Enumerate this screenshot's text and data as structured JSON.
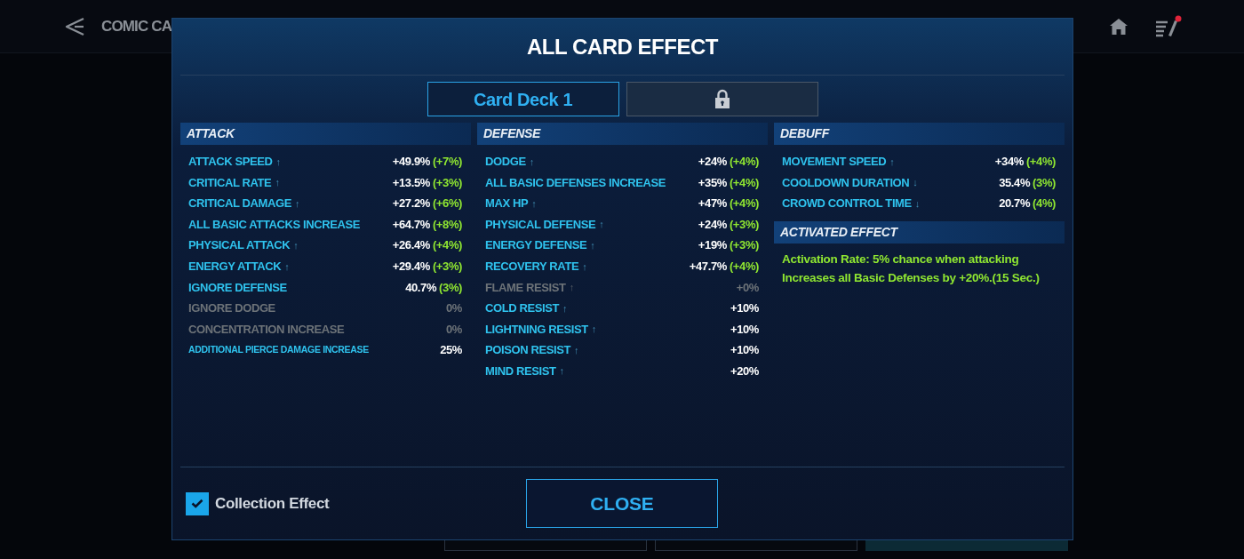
{
  "background": {
    "title": "COMIC CA"
  },
  "dialog": {
    "title": "ALL CARD EFFECT",
    "tabs": [
      {
        "kind": "deck",
        "label": "Card Deck 1",
        "selected": true
      },
      {
        "kind": "locked",
        "selected": false
      }
    ],
    "sections": [
      {
        "title": "ATTACK",
        "rows": [
          {
            "kind": "normal",
            "label": "ATTACK SPEED",
            "arrow": "↑",
            "value": "+49.9%",
            "bonus": "(+7%)",
            "disabled": false
          },
          {
            "kind": "normal",
            "label": "CRITICAL RATE",
            "arrow": "↑",
            "value": "+13.5%",
            "bonus": "(+3%)",
            "disabled": false
          },
          {
            "kind": "normal",
            "label": "CRITICAL DAMAGE",
            "arrow": "↑",
            "value": "+27.2%",
            "bonus": "(+6%)",
            "disabled": false
          },
          {
            "kind": "normal",
            "label": "ALL BASIC ATTACKS INCREASE",
            "value": "+64.7%",
            "bonus": "(+8%)",
            "disabled": false
          },
          {
            "kind": "normal",
            "label": "PHYSICAL ATTACK",
            "arrow": "↑",
            "value": "+26.4%",
            "bonus": "(+4%)",
            "disabled": false
          },
          {
            "kind": "normal",
            "label": "ENERGY ATTACK",
            "arrow": "↑",
            "value": "+29.4%",
            "bonus": "(+3%)",
            "disabled": false
          },
          {
            "kind": "normal",
            "label": "IGNORE DEFENSE",
            "value": "40.7%",
            "bonus": "(3%)",
            "disabled": false
          },
          {
            "kind": "normal",
            "label": "IGNORE DODGE",
            "value": "0%",
            "disabled": true
          },
          {
            "kind": "normal",
            "label": "CONCENTRATION INCREASE",
            "value": "0%",
            "disabled": true
          },
          {
            "kind": "compact",
            "label": "ADDITIONAL PIERCE DAMAGE INCREASE",
            "value": "25%",
            "disabled": false
          }
        ]
      },
      {
        "title": "DEFENSE",
        "rows": [
          {
            "kind": "normal",
            "label": "DODGE",
            "arrow": "↑",
            "value": "+24%",
            "bonus": "(+4%)",
            "disabled": false
          },
          {
            "kind": "normal",
            "label": "ALL BASIC DEFENSES INCREASE",
            "value": "+35%",
            "bonus": "(+4%)",
            "disabled": false
          },
          {
            "kind": "normal",
            "label": "MAX HP",
            "arrow": "↑",
            "value": "+47%",
            "bonus": "(+4%)",
            "disabled": false
          },
          {
            "kind": "normal",
            "label": "PHYSICAL DEFENSE",
            "arrow": "↑",
            "value": "+24%",
            "bonus": "(+3%)",
            "disabled": false
          },
          {
            "kind": "normal",
            "label": "ENERGY DEFENSE",
            "arrow": "↑",
            "value": "+19%",
            "bonus": "(+3%)",
            "disabled": false
          },
          {
            "kind": "normal",
            "label": "RECOVERY RATE",
            "arrow": "↑",
            "value": "+47.7%",
            "bonus": "(+4%)",
            "disabled": false
          },
          {
            "kind": "normal",
            "label": "FLAME RESIST",
            "arrow": "↑",
            "value": "+0%",
            "disabled": true
          },
          {
            "kind": "normal",
            "label": "COLD RESIST",
            "arrow": "↑",
            "value": "+10%",
            "disabled": false
          },
          {
            "kind": "normal",
            "label": "LIGHTNING RESIST",
            "arrow": "↑",
            "value": "+10%",
            "disabled": false
          },
          {
            "kind": "normal",
            "label": "POISON RESIST",
            "arrow": "↑",
            "value": "+10%",
            "disabled": false
          },
          {
            "kind": "normal",
            "label": "MIND RESIST",
            "arrow": "↑",
            "value": "+20%",
            "disabled": false
          }
        ]
      },
      {
        "title": "DEBUFF",
        "rows": [
          {
            "kind": "normal",
            "label": "MOVEMENT SPEED",
            "arrow": "↑",
            "value": "+34%",
            "bonus": "(+4%)",
            "disabled": false
          },
          {
            "kind": "normal",
            "label": "COOLDOWN DURATION",
            "arrow": "↓",
            "value": "35.4%",
            "bonus": "(3%)",
            "disabled": false
          },
          {
            "kind": "normal",
            "label": "CROWD CONTROL TIME",
            "arrow": "↓",
            "value": "20.7%",
            "bonus": "(4%)",
            "disabled": false
          }
        ]
      }
    ],
    "activated_effect": {
      "title": "ACTIVATED EFFECT",
      "lines": [
        "Activation Rate: 5% chance when attacking",
        "Increases all Basic Defenses by +20%.(15 Sec.)"
      ]
    },
    "collection_effect": {
      "label": "Collection Effect",
      "checked": true
    },
    "close_button": "CLOSE"
  }
}
